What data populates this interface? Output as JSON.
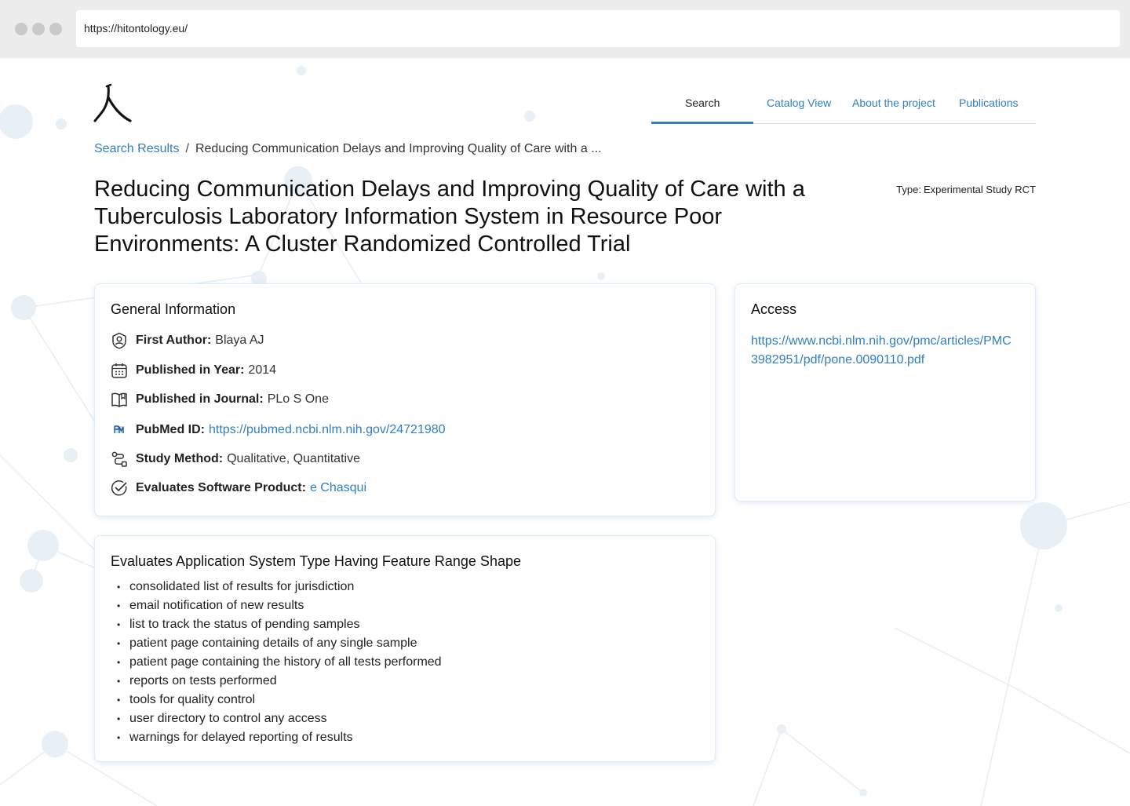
{
  "browser": {
    "url": "https://hitontology.eu/"
  },
  "logo": {
    "glyph": "人"
  },
  "nav": {
    "tabs": [
      {
        "label": "Search",
        "active": true
      },
      {
        "label": "Catalog View",
        "active": false
      },
      {
        "label": "About the project",
        "active": false
      },
      {
        "label": "Publications",
        "active": false
      }
    ]
  },
  "breadcrumb": {
    "root": "Search Results",
    "separator": "/",
    "current": "Reducing Communication Delays and Improving Quality of Care with a ..."
  },
  "page": {
    "title": "Reducing Communication Delays and Improving Quality of Care with a Tuberculosis Laboratory Information System in Resource Poor Environments: A Cluster Randomized Controlled Trial",
    "type_label": "Type:",
    "type_value": "Experimental Study RCT"
  },
  "general_info": {
    "heading": "General Information",
    "first_author": {
      "label": "First Author:",
      "value": "Blaya AJ",
      "icon": "user-badge-icon"
    },
    "year": {
      "label": "Published in Year:",
      "value": "2014",
      "icon": "calendar-icon"
    },
    "journal": {
      "label": "Published in Journal:",
      "value": "PLo S One",
      "icon": "book-icon"
    },
    "pubmed": {
      "label": "PubMed ID:",
      "value": "https://pubmed.ncbi.nlm.nih.gov/24721980",
      "icon": "pubmed-icon"
    },
    "method": {
      "label": "Study Method:",
      "value": "Qualitative, Quantitative",
      "icon": "route-icon"
    },
    "product": {
      "label": "Evaluates Software Product:",
      "value": "e Chasqui",
      "icon": "check-circle-icon"
    }
  },
  "access": {
    "heading": "Access",
    "url": "https://www.ncbi.nlm.nih.gov/pmc/articles/PMC3982951/pdf/pone.0090110.pdf"
  },
  "features": {
    "heading": "Evaluates Application System Type Having Feature Range Shape",
    "items": [
      "consolidated list of results for jurisdiction",
      "email notification of new results",
      "list to track the status of pending samples",
      "patient page containing details of any single sample",
      "patient page containing the history of all tests performed",
      "reports on tests performed",
      "tools for quality control",
      "user directory to control any access",
      "warnings for delayed reporting of results"
    ]
  },
  "colors": {
    "accent": "#2f7fc1",
    "text": "#1a1a1a",
    "card_border": "#dcebf4"
  }
}
